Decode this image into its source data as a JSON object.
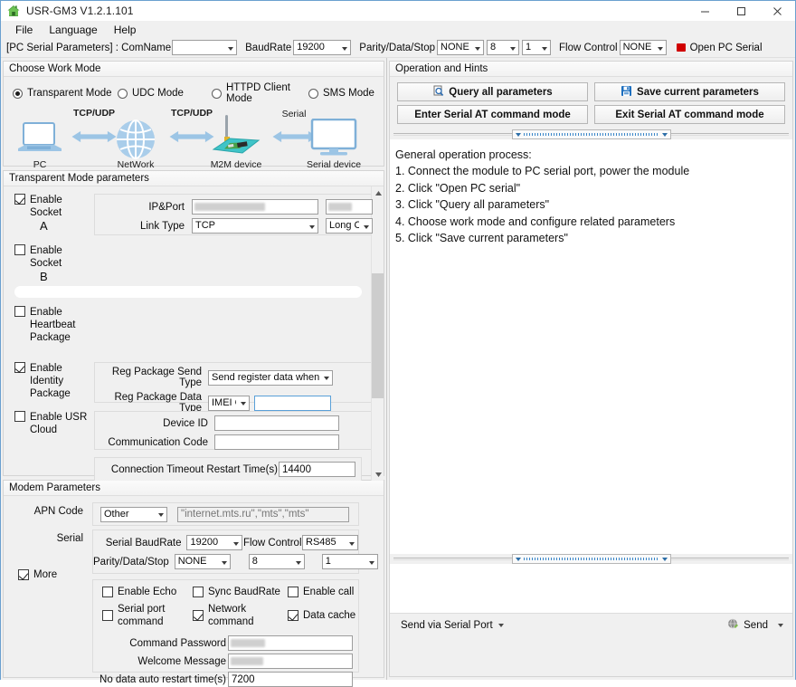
{
  "window": {
    "title": "USR-GM3 V1.2.1.101",
    "icon": "house-icon",
    "minimize": "–",
    "maximize": "☐",
    "close": "✕"
  },
  "menu": {
    "items": [
      "File",
      "Language",
      "Help"
    ]
  },
  "serial_toolbar": {
    "prefix_label": "[PC Serial Parameters] : ComName",
    "comname_value": "",
    "baudrate_label": "BaudRate",
    "baudrate_value": "19200",
    "parity_label": "Parity/Data/Stop",
    "parity_value": "NONE",
    "data_value": "8",
    "stop_value": "1",
    "flow_label": "Flow Control",
    "flow_value": "NONE",
    "open_serial_label": "Open PC Serial",
    "led_color": "#d00000"
  },
  "work_mode": {
    "group_title": "Choose Work Mode",
    "options": [
      {
        "label": "Transparent Mode",
        "selected": true
      },
      {
        "label": "UDC Mode",
        "selected": false
      },
      {
        "label": "HTTPD Client Mode",
        "selected": false
      },
      {
        "label": "SMS Mode",
        "selected": false
      }
    ],
    "diagram": {
      "nodes": [
        "PC",
        "NetWork",
        "M2M device",
        "Serial device"
      ],
      "links": [
        "TCP/UDP",
        "TCP/UDP",
        "Serial"
      ],
      "accent_color": "#8ab4dc"
    }
  },
  "transparent": {
    "group_title": "Transparent Mode parameters",
    "socket_a": {
      "checkbox_label_line1": "Enable Socket",
      "checkbox_label_line2": "A",
      "checked": true,
      "ipport_label": "IP&Port",
      "ip_value": "",
      "port_value": "",
      "linktype_label": "Link Type",
      "linktype_value": "TCP",
      "connection_value": "Long C"
    },
    "socket_b": {
      "checkbox_label_line1": "Enable Socket",
      "checkbox_label_line2": "B",
      "checked": false
    },
    "heartbeat": {
      "label_line1": "Enable",
      "label_line2": "Heartbeat",
      "label_line3": "Package",
      "checked": false
    },
    "identity": {
      "label_line1": "Enable",
      "label_line2": "Identity",
      "label_line3": "Package",
      "checked": true,
      "send_type_label": "Reg Package Send Type",
      "send_type_value": "Send register data when socke",
      "data_type_label": "Reg Package Data Type",
      "data_type_value": "IMEI Co",
      "data_value": ""
    },
    "usr_cloud": {
      "label_line1": "Enable USR",
      "label_line2": "Cloud",
      "checked": false,
      "device_id_label": "Device ID",
      "device_id_value": "",
      "comm_code_label": "Communication Code",
      "comm_code_value": ""
    },
    "timeout": {
      "label": "Connection Timeout Restart Time(s)",
      "value": "14400"
    }
  },
  "modem": {
    "group_title": "Modem Parameters",
    "apn_label": "APN Code",
    "apn_select_value": "Other",
    "apn_placeholder": "\"internet.mts.ru\",\"mts\",\"mts\"",
    "apn_value": "",
    "serial_label": "Serial",
    "more_label": "More",
    "more_checked": true,
    "baudrate_label": "Serial BaudRate",
    "baudrate_value": "19200",
    "flow_label": "Flow Control",
    "flow_value": "RS485",
    "parity_label": "Parity/Data/Stop",
    "parity_value": "NONE",
    "data_value": "8",
    "stop_value": "1",
    "checkboxes": [
      {
        "label": "Enable Echo",
        "checked": false
      },
      {
        "label": "Sync BaudRate",
        "checked": false
      },
      {
        "label": "Enable call",
        "checked": false
      },
      {
        "label": "Serial port command",
        "checked": false
      },
      {
        "label": "Network command",
        "checked": true
      },
      {
        "label": "Data cache",
        "checked": true
      }
    ],
    "command_password_label": "Command Password",
    "command_password_value": "",
    "welcome_message_label": "Welcome Message",
    "welcome_message_value": "",
    "no_data_restart_label": "No data auto restart time(s)",
    "no_data_restart_value": "7200"
  },
  "operation": {
    "group_title": "Operation and Hints",
    "buttons": [
      {
        "label": "Query all parameters",
        "icon": "magnifier-document-icon"
      },
      {
        "label": "Save current parameters",
        "icon": "floppy-disk-icon"
      },
      {
        "label": "Enter Serial AT command mode",
        "icon": ""
      },
      {
        "label": "Exit Serial AT command mode",
        "icon": ""
      }
    ],
    "hints": [
      "General operation process:",
      "1. Connect the module to PC serial port, power the module",
      "2. Click \"Open PC serial\"",
      "3. Click \"Query all parameters\"",
      "4. Choose work mode and configure related parameters",
      "5. Click \"Save current parameters\""
    ]
  },
  "status_bar": {
    "send_via_label": "Send via Serial Port",
    "send_label": "Send",
    "send_icon": "globe-pencil-icon"
  }
}
